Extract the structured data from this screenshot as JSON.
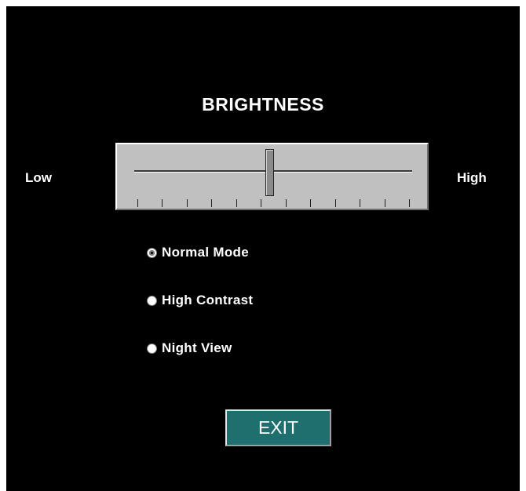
{
  "title": "BRIGHTNESS",
  "slider": {
    "low_label": "Low",
    "high_label": "High",
    "value_fraction": 0.49,
    "tick_count": 12
  },
  "modes": [
    {
      "label": "Normal Mode",
      "selected": true
    },
    {
      "label": "High Contrast",
      "selected": false
    },
    {
      "label": "Night View",
      "selected": false
    }
  ],
  "exit_label": "EXIT",
  "colors": {
    "background": "#000000",
    "slider_face": "#c0c0c0",
    "exit_button": "#1f6f6f",
    "text": "#ffffff"
  }
}
